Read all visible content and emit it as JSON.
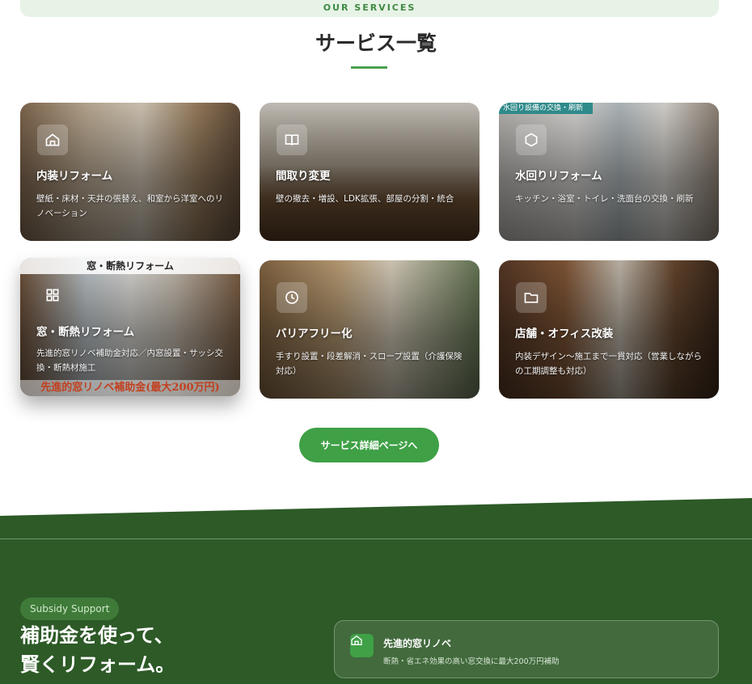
{
  "section": {
    "eyebrow": "OUR SERVICES",
    "title": "サービス一覧"
  },
  "cards": [
    {
      "title": "内装リフォーム",
      "desc": "壁紙・床材・天井の張替え、和室から洋室へのリノベーション",
      "icon": "home-icon"
    },
    {
      "title": "間取り変更",
      "desc": "壁の撤去・増設、LDK拡張、部屋の分割・統合",
      "icon": "book-icon"
    },
    {
      "title": "水回りリフォーム",
      "desc": "キッチン・浴室・トイレ・洗面台の交換・刷新",
      "icon": "hexagon-icon",
      "photo_tag": "水回り設備の交換・刷新"
    },
    {
      "title": "窓・断熱リフォーム",
      "desc": "先進的窓リノベ補助金対応／内窓設置・サッシ交換・断熱材施工",
      "icon": "grid-icon",
      "photo_banner": "窓・断熱リフォーム",
      "photo_bottom": "先進的窓リノベ補助金(最大200万円)"
    },
    {
      "title": "バリアフリー化",
      "desc": "手すり設置・段差解消・スロープ設置（介護保険対応）",
      "icon": "clock-icon"
    },
    {
      "title": "店舗・オフィス改装",
      "desc": "内装デザイン〜施工まで一貫対応（営業しながらの工期調整も対応）",
      "icon": "folder-icon"
    }
  ],
  "cta": {
    "label": "サービス詳細ページへ"
  },
  "subsidy": {
    "chip": "Subsidy Support",
    "heading_line1": "補助金を使って、",
    "heading_line2": "賢くリフォーム。",
    "card_title": "先進的窓リノベ",
    "card_desc": "断熱・省エネ効果の高い窓交換に最大200万円補助",
    "icon": "home-icon"
  },
  "colors": {
    "accent": "#3fa046",
    "band": "#2d5a27",
    "title": "#2b2b2b"
  }
}
